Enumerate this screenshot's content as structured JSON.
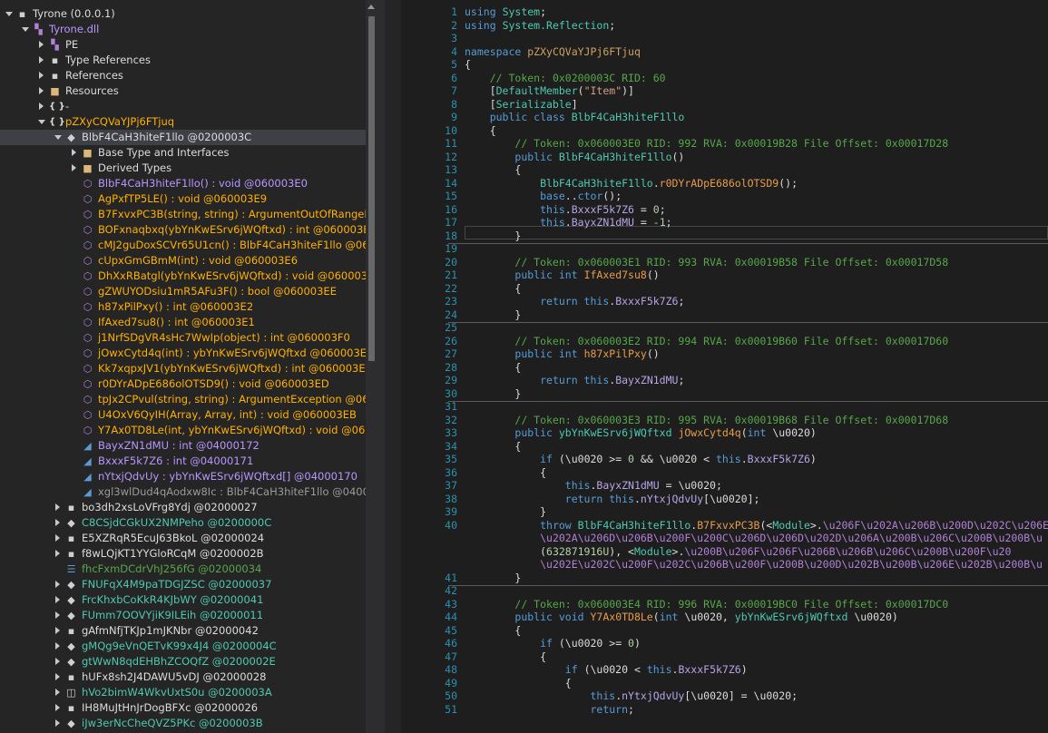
{
  "tree": {
    "items": [
      {
        "depth": 0,
        "exp": "open",
        "icon": "assembly-icon",
        "glyph": "▪",
        "iconClass": "cls",
        "label": "Tyrone (0.0.0.1)",
        "cls": "c-white"
      },
      {
        "depth": 1,
        "exp": "open",
        "icon": "dll-icon",
        "glyph": "▚",
        "iconClass": "dll",
        "label": "Tyrone.dll",
        "cls": "c-purple"
      },
      {
        "depth": 2,
        "exp": "col",
        "icon": "pe-icon",
        "glyph": "▚",
        "iconClass": "dll",
        "label": "PE",
        "cls": "c-white"
      },
      {
        "depth": 2,
        "exp": "col",
        "icon": "references-icon",
        "glyph": "▪",
        "iconClass": "cls",
        "label": "Type References",
        "cls": "c-white"
      },
      {
        "depth": 2,
        "exp": "col",
        "icon": "references-icon",
        "glyph": "▪",
        "iconClass": "cls",
        "label": "References",
        "cls": "c-white"
      },
      {
        "depth": 2,
        "exp": "col",
        "icon": "folder-icon",
        "glyph": "■",
        "iconClass": "folder",
        "label": "Resources",
        "cls": "c-white"
      },
      {
        "depth": 2,
        "exp": "col",
        "icon": "namespace-icon",
        "glyph": "{ }",
        "iconClass": "ns",
        "label": "-",
        "cls": "c-white"
      },
      {
        "depth": 2,
        "exp": "open",
        "icon": "namespace-icon",
        "glyph": "{ }",
        "iconClass": "ns",
        "label": "pZXyCQVaYJPj6FTjuq",
        "cls": "c-orange"
      },
      {
        "depth": 3,
        "exp": "open",
        "icon": "class-icon",
        "glyph": "◆",
        "iconClass": "cls",
        "label": "BlbF4CaH3hiteF1llo @0200003C",
        "cls": "c-white",
        "sel": true
      },
      {
        "depth": 4,
        "exp": "col",
        "icon": "folder-icon",
        "glyph": "■",
        "iconClass": "folder",
        "label": "Base Type and Interfaces",
        "cls": "c-white"
      },
      {
        "depth": 4,
        "exp": "col",
        "icon": "folder-icon",
        "glyph": "■",
        "iconClass": "folder",
        "label": "Derived Types",
        "cls": "c-white"
      },
      {
        "depth": 4,
        "exp": "none",
        "icon": "method-icon",
        "glyph": "⬡",
        "iconClass": "method",
        "label": "BlbF4CaH3hiteF1llo() : void @060003E0",
        "cls": "c-purple"
      },
      {
        "depth": 4,
        "exp": "none",
        "icon": "method-icon",
        "glyph": "⬡",
        "iconClass": "method",
        "label": "AgPxfTP5LE() : void @060003E9",
        "cls": "c-orange"
      },
      {
        "depth": 4,
        "exp": "none",
        "icon": "method-icon",
        "glyph": "⬡",
        "iconClass": "method",
        "label": "B7FxvxPC3B(string, string) : ArgumentOutOfRangeExce",
        "cls": "c-orange"
      },
      {
        "depth": 4,
        "exp": "none",
        "icon": "method-icon",
        "glyph": "⬡",
        "iconClass": "method",
        "label": "BOFxnaqbxq(ybYnKwESrv6jWQftxd) : int @060003E5",
        "cls": "c-orange"
      },
      {
        "depth": 4,
        "exp": "none",
        "icon": "method-icon",
        "glyph": "⬡",
        "iconClass": "method",
        "label": "cMJ2guDoxSCVr65U1cn() : BlbF4CaH3hiteF1llo @06000",
        "cls": "c-orange"
      },
      {
        "depth": 4,
        "exp": "none",
        "icon": "method-icon",
        "glyph": "⬡",
        "iconClass": "method",
        "label": "cUpxGmGBmM(int) : void @060003E6",
        "cls": "c-orange"
      },
      {
        "depth": 4,
        "exp": "none",
        "icon": "method-icon",
        "glyph": "⬡",
        "iconClass": "method",
        "label": "DhXxRBatgl(ybYnKwESrv6jWQftxd) : void @060003E7",
        "cls": "c-orange"
      },
      {
        "depth": 4,
        "exp": "none",
        "icon": "method-icon",
        "glyph": "⬡",
        "iconClass": "method",
        "label": "gZWUYODsiu1mR5AFu3F() : bool @060003EE",
        "cls": "c-orange"
      },
      {
        "depth": 4,
        "exp": "none",
        "icon": "method-icon",
        "glyph": "⬡",
        "iconClass": "method",
        "label": "h87xPilPxy() : int @060003E2",
        "cls": "c-orange"
      },
      {
        "depth": 4,
        "exp": "none",
        "icon": "method-icon",
        "glyph": "⬡",
        "iconClass": "method",
        "label": "IfAxed7su8() : int @060003E1",
        "cls": "c-orange"
      },
      {
        "depth": 4,
        "exp": "none",
        "icon": "method-icon",
        "glyph": "⬡",
        "iconClass": "method",
        "label": "j1NrfSDgVR4sHc7WwIp(object) : int @060003F0",
        "cls": "c-orange"
      },
      {
        "depth": 4,
        "exp": "none",
        "icon": "method-icon",
        "glyph": "⬡",
        "iconClass": "method",
        "label": "jOwxCytd4q(int) : ybYnKwESrv6jWQftxd @060003E3",
        "cls": "c-orange"
      },
      {
        "depth": 4,
        "exp": "none",
        "icon": "method-icon",
        "glyph": "⬡",
        "iconClass": "method",
        "label": "Kk7xqpxJV1(ybYnKwESrv6jWQftxd) : int @060003E8",
        "cls": "c-orange"
      },
      {
        "depth": 4,
        "exp": "none",
        "icon": "method-icon",
        "glyph": "⬡",
        "iconClass": "method",
        "label": "r0DYrADpE686olOTSD9() : void @060003ED",
        "cls": "c-orange"
      },
      {
        "depth": 4,
        "exp": "none",
        "icon": "method-icon",
        "glyph": "⬡",
        "iconClass": "method",
        "label": "tpJx2CPvul(string, string) : ArgumentException @06000",
        "cls": "c-orange"
      },
      {
        "depth": 4,
        "exp": "none",
        "icon": "method-icon",
        "glyph": "⬡",
        "iconClass": "method",
        "label": "U4OxV6QyIH(Array, Array, int) : void @060003EB",
        "cls": "c-orange"
      },
      {
        "depth": 4,
        "exp": "none",
        "icon": "method-icon",
        "glyph": "⬡",
        "iconClass": "method",
        "label": "Y7Ax0TD8Le(int, ybYnKwESrv6jWQftxd) : void @060003",
        "cls": "c-orange"
      },
      {
        "depth": 4,
        "exp": "none",
        "icon": "field-icon",
        "glyph": "◢",
        "iconClass": "field",
        "label": "BayxZN1dMU : int @04000172",
        "cls": "c-purple"
      },
      {
        "depth": 4,
        "exp": "none",
        "icon": "field-icon",
        "glyph": "◢",
        "iconClass": "field",
        "label": "BxxxF5k7Z6 : int @04000171",
        "cls": "c-purple"
      },
      {
        "depth": 4,
        "exp": "none",
        "icon": "field-icon",
        "glyph": "◢",
        "iconClass": "field",
        "label": "nYtxjQdvUy : ybYnKwESrv6jWQftxd[] @04000170",
        "cls": "c-purple"
      },
      {
        "depth": 4,
        "exp": "none",
        "icon": "field-icon",
        "glyph": "◢",
        "iconClass": "field",
        "label": "xgl3wlDud4qAodxw8Ic : BlbF4CaH3hiteF1llo @0400017",
        "cls": "c-gray"
      },
      {
        "depth": 3,
        "exp": "col",
        "icon": "class-icon",
        "glyph": "▪",
        "iconClass": "cls",
        "label": "bo3dh2xsLoVFrg8Ydj @02000027",
        "cls": "c-white"
      },
      {
        "depth": 3,
        "exp": "col",
        "icon": "class-icon",
        "glyph": "◆",
        "iconClass": "cls",
        "label": "C8CSjdCGkUX2NMPeho @0200000C",
        "cls": "c-type"
      },
      {
        "depth": 3,
        "exp": "col",
        "icon": "class-icon",
        "glyph": "▪",
        "iconClass": "cls",
        "label": "E5XZRqR5EcuJ63BkoL @02000024",
        "cls": "c-white"
      },
      {
        "depth": 3,
        "exp": "col",
        "icon": "class-icon",
        "glyph": "▪",
        "iconClass": "cls",
        "label": "f8wLQjKT1YYGloRCqM @0200002B",
        "cls": "c-white"
      },
      {
        "depth": 3,
        "exp": "none",
        "icon": "enum-icon",
        "glyph": "☰",
        "iconClass": "enum",
        "label": "fhcFxmDCdrVhJ256fG @02000034",
        "cls": "c-green"
      },
      {
        "depth": 3,
        "exp": "col",
        "icon": "class-icon",
        "glyph": "◆",
        "iconClass": "cls",
        "label": "FNUFqX4M9paTDGJZSC @02000037",
        "cls": "c-type"
      },
      {
        "depth": 3,
        "exp": "col",
        "icon": "class-icon",
        "glyph": "◆",
        "iconClass": "cls",
        "label": "FrcKhxbCoKkR4KJbWY @02000041",
        "cls": "c-type"
      },
      {
        "depth": 3,
        "exp": "col",
        "icon": "class-icon",
        "glyph": "◆",
        "iconClass": "cls",
        "label": "FUmm7OOVYjiK9ILEih @02000011",
        "cls": "c-type"
      },
      {
        "depth": 3,
        "exp": "col",
        "icon": "class-icon",
        "glyph": "▪",
        "iconClass": "cls",
        "label": "gAfmNfjTKJp1mJKNbr @02000042",
        "cls": "c-white"
      },
      {
        "depth": 3,
        "exp": "col",
        "icon": "class-icon",
        "glyph": "◆",
        "iconClass": "cls",
        "label": "gMQg9eVnQETvK99x4J4 @0200004C",
        "cls": "c-type"
      },
      {
        "depth": 3,
        "exp": "col",
        "icon": "class-icon",
        "glyph": "◆",
        "iconClass": "cls",
        "label": "gtWwN8qdEHBhZCOQfZ @0200002E",
        "cls": "c-type"
      },
      {
        "depth": 3,
        "exp": "col",
        "icon": "class-icon",
        "glyph": "▪",
        "iconClass": "cls",
        "label": "hUFx8sh2J4DAWU5vDJ @02000028",
        "cls": "c-white"
      },
      {
        "depth": 3,
        "exp": "col",
        "icon": "interface-icon",
        "glyph": "◫",
        "iconClass": "cls",
        "label": "hVo2bimW4WkvUxtS0u @0200003A",
        "cls": "c-type"
      },
      {
        "depth": 3,
        "exp": "col",
        "icon": "class-icon",
        "glyph": "▪",
        "iconClass": "cls",
        "label": "IH8MuJtHnJrDogBFXc @02000026",
        "cls": "c-white"
      },
      {
        "depth": 3,
        "exp": "col",
        "icon": "class-icon",
        "glyph": "◆",
        "iconClass": "cls",
        "label": "iJw3erNcCheQVZ5PKc @0200003B",
        "cls": "c-type"
      }
    ]
  },
  "code": {
    "lines": [
      {
        "n": "1",
        "h": "<span class='kw'>using</span> <span class='ty'>System</span>;"
      },
      {
        "n": "2",
        "h": "<span class='kw'>using</span> <span class='ty'>System.Reflection</span>;"
      },
      {
        "n": "3",
        "h": ""
      },
      {
        "n": "4",
        "h": "<span class='kw'>namespace</span> <span class='ns2'>pZXyCQVaYJPj6FTjuq</span>"
      },
      {
        "n": "5",
        "h": "{"
      },
      {
        "n": "6",
        "h": "    <span class='cm'>// Token: 0x0200003C RID: 60</span>"
      },
      {
        "n": "7",
        "h": "    [<span class='ty'>DefaultMember</span>(<span class='st'>\"Item\"</span>)]"
      },
      {
        "n": "8",
        "h": "    [<span class='ty'>Serializable</span>]"
      },
      {
        "n": "9",
        "h": "    <span class='kw'>public class</span> <span class='ty'>BlbF4CaH3hiteF1llo</span>"
      },
      {
        "n": "10",
        "h": "    {"
      },
      {
        "n": "11",
        "h": "        <span class='cm'>// Token: 0x060003E0 RID: 992 RVA: 0x00019B28 File Offset: 0x00017D28</span>"
      },
      {
        "n": "12",
        "h": "        <span class='kw'>public</span> <span class='ty'>BlbF4CaH3hiteF1llo</span>()"
      },
      {
        "n": "13",
        "h": "        {"
      },
      {
        "n": "14",
        "h": "            <span class='ty'>BlbF4CaH3hiteF1llo</span>.<span class='mth'>r0DYrADpE686olOTSD9</span>();"
      },
      {
        "n": "15",
        "h": "            <span class='kw'>base</span>..<span class='kw'>ctor</span>();"
      },
      {
        "n": "16",
        "h": "            <span class='kw'>this</span>.<span class='fd'>BxxxF5k7Z6</span> = <span class='nm'>0</span>;"
      },
      {
        "n": "17",
        "h": "            <span class='kw'>this</span>.<span class='fd'>BayxZN1dMU</span> = <span class='nm'>-1</span>;"
      },
      {
        "n": "18",
        "h": "        }",
        "sep": true
      },
      {
        "n": "19",
        "h": ""
      },
      {
        "n": "20",
        "h": "        <span class='cm'>// Token: 0x060003E1 RID: 993 RVA: 0x00019B58 File Offset: 0x00017D58</span>"
      },
      {
        "n": "21",
        "h": "        <span class='kw'>public int</span> <span class='mth'>IfAxed7su8</span>()"
      },
      {
        "n": "22",
        "h": "        {"
      },
      {
        "n": "23",
        "h": "            <span class='kw'>return this</span>.<span class='fd'>BxxxF5k7Z6</span>;"
      },
      {
        "n": "24",
        "h": "        }",
        "sep": true
      },
      {
        "n": "25",
        "h": ""
      },
      {
        "n": "26",
        "h": "        <span class='cm'>// Token: 0x060003E2 RID: 994 RVA: 0x00019B60 File Offset: 0x00017D60</span>"
      },
      {
        "n": "27",
        "h": "        <span class='kw'>public int</span> <span class='mth'>h87xPilPxy</span>()"
      },
      {
        "n": "28",
        "h": "        {"
      },
      {
        "n": "29",
        "h": "            <span class='kw'>return this</span>.<span class='fd'>BayxZN1dMU</span>;"
      },
      {
        "n": "30",
        "h": "        }",
        "sep": true
      },
      {
        "n": "31",
        "h": ""
      },
      {
        "n": "32",
        "h": "        <span class='cm'>// Token: 0x060003E3 RID: 995 RVA: 0x00019B68 File Offset: 0x00017D68</span>"
      },
      {
        "n": "33",
        "h": "        <span class='kw'>public</span> <span class='ty'>ybYnKwESrv6jWQftxd</span> <span class='mth'>jOwxCytd4q</span>(<span class='kw'>int</span> \\u0020)"
      },
      {
        "n": "34",
        "h": "        {"
      },
      {
        "n": "35",
        "h": "            <span class='kw'>if</span> (\\u0020 &gt;= <span class='nm'>0</span> &amp;&amp; \\u0020 &lt; <span class='kw'>this</span>.<span class='fd'>BxxxF5k7Z6</span>)"
      },
      {
        "n": "36",
        "h": "            {"
      },
      {
        "n": "37",
        "h": "                <span class='kw'>this</span>.<span class='fd'>BayxZN1dMU</span> = \\u0020;"
      },
      {
        "n": "38",
        "h": "                <span class='kw'>return this</span>.<span class='fd'>nYtxjQdvUy</span>[\\u0020];"
      },
      {
        "n": "39",
        "h": "            }"
      },
      {
        "n": "40",
        "h": "            <span class='kw'>throw</span> <span class='ty'>BlbF4CaH3hiteF1llo</span>.<span class='mth'>B7FxvxPC3B</span>(&lt;<span class='ty'>Module</span>&gt;.<span class='mm'>\\u206F\\u202A\\u206B\\u200D\\u202C\\u206E\\u</span>"
      },
      {
        "n": "",
        "h": "            <span class='mm'>\\u202A\\u206D\\u206B\\u200F\\u200C\\u206D\\u206D\\u202D\\u206A\\u200B\\u206C\\u200B\\u200B\\u</span>"
      },
      {
        "n": "",
        "h": "            (<span class='nm'>632871916U</span>), &lt;<span class='ty'>Module</span>&gt;.<span class='mm'>\\u200B\\u206F\\u206F\\u206B\\u206B\\u206C\\u200B\\u200F\\u20</span>"
      },
      {
        "n": "",
        "h": "            <span class='mm'>\\u202E\\u202C\\u200F\\u202C\\u206B\\u200F\\u200B\\u200D\\u202B\\u200B\\u206E\\u202B\\u200B\\u</span>"
      },
      {
        "n": "41",
        "h": "        }",
        "sep": true
      },
      {
        "n": "42",
        "h": ""
      },
      {
        "n": "43",
        "h": "        <span class='cm'>// Token: 0x060003E4 RID: 996 RVA: 0x00019BC0 File Offset: 0x00017DC0</span>"
      },
      {
        "n": "44",
        "h": "        <span class='kw'>public void</span> <span class='mth'>Y7Ax0TD8Le</span>(<span class='kw'>int</span> \\u0020, <span class='ty'>ybYnKwESrv6jWQftxd</span> \\u0020)"
      },
      {
        "n": "45",
        "h": "        {"
      },
      {
        "n": "46",
        "h": "            <span class='kw'>if</span> (\\u0020 &gt;= <span class='nm'>0</span>)"
      },
      {
        "n": "47",
        "h": "            {"
      },
      {
        "n": "48",
        "h": "                <span class='kw'>if</span> (\\u0020 &lt; <span class='kw'>this</span>.<span class='fd'>BxxxF5k7Z6</span>)"
      },
      {
        "n": "49",
        "h": "                {"
      },
      {
        "n": "50",
        "h": "                    <span class='kw'>this</span>.<span class='fd'>nYtxjQdvUy</span>[\\u0020] = \\u0020;"
      },
      {
        "n": "51",
        "h": "                    <span class='kw'>return</span>;"
      }
    ]
  }
}
